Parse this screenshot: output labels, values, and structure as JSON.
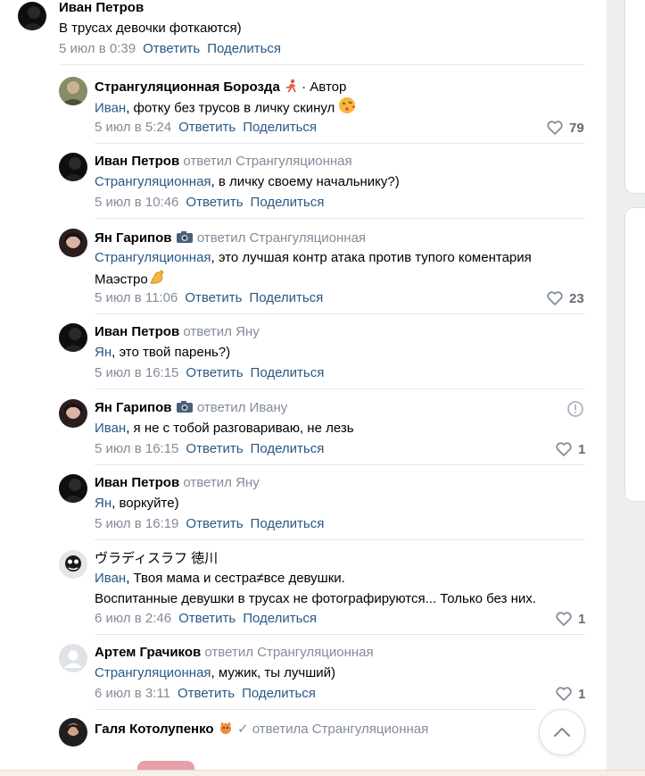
{
  "comments": [
    {
      "name": "Иван Петров",
      "reply": "",
      "tag": "",
      "text_mention": "",
      "text": "В трусах девочки фоткаются)",
      "date": "5 июл в 0:39",
      "reply_btn": "Ответить",
      "share_btn": "Поделиться",
      "likes": ""
    },
    {
      "name": "Странгуляционная Борозда",
      "reply": "",
      "tag": "· Автор",
      "text_mention": "Иван",
      "text": ", фотку без трусов в личку скинул",
      "date": "5 июл в 5:24",
      "reply_btn": "Ответить",
      "share_btn": "Поделиться",
      "likes": "79"
    },
    {
      "name": "Иван Петров",
      "reply": "ответил Странгуляционная",
      "tag": "",
      "text_mention": "Странгуляционная",
      "text": ", в личку своему начальнику?)",
      "date": "5 июл в 10:46",
      "reply_btn": "Ответить",
      "share_btn": "Поделиться",
      "likes": ""
    },
    {
      "name": "Ян Гарипов",
      "reply": "ответил Странгуляционная",
      "tag": "",
      "text_mention": "Странгуляционная",
      "text": ", это лучшая контр атака против тупого коментария",
      "text2": "Маэстро",
      "date": "5 июл в 11:06",
      "reply_btn": "Ответить",
      "share_btn": "Поделиться",
      "likes": "23"
    },
    {
      "name": "Иван Петров",
      "reply": "ответил Яну",
      "tag": "",
      "text_mention": "Ян",
      "text": ", это твой парень?)",
      "date": "5 июл в 16:15",
      "reply_btn": "Ответить",
      "share_btn": "Поделиться",
      "likes": ""
    },
    {
      "name": "Ян Гарипов",
      "reply": "ответил Ивану",
      "tag": "",
      "text_mention": "Иван",
      "text": ", я не с тобой разговариваю, не лезь",
      "date": "5 июл в 16:15",
      "reply_btn": "Ответить",
      "share_btn": "Поделиться",
      "likes": "1"
    },
    {
      "name": "Иван Петров",
      "reply": "ответил Яну",
      "tag": "",
      "text_mention": "Ян",
      "text": ", воркуйте)",
      "date": "5 июл в 16:19",
      "reply_btn": "Ответить",
      "share_btn": "Поделиться",
      "likes": ""
    },
    {
      "name": "ヴラディスラフ 徳川",
      "reply": "",
      "tag": "",
      "text_mention": "Иван",
      "text": ", Твоя мама и сестра≠все девушки.",
      "text2": "Воспитанные девушки в трусах не фотографируются... Только без них.",
      "date": "6 июл в 2:46",
      "reply_btn": "Ответить",
      "share_btn": "Поделиться",
      "likes": "1"
    },
    {
      "name": "Артем Грачиков",
      "reply": "ответил Странгуляционная",
      "tag": "",
      "text_mention": "Странгуляционная",
      "text": ", мужик, ты лучший)",
      "date": "6 июл в 3:11",
      "reply_btn": "Ответить",
      "share_btn": "Поделиться",
      "likes": "1"
    },
    {
      "name": "Галя Котолупенко",
      "reply": "ответила Странгуляционная",
      "tag": "",
      "text_mention": "",
      "text": "",
      "date": "",
      "reply_btn": "",
      "share_btn": "",
      "likes": ""
    }
  ],
  "icons": {
    "like": "heart-icon",
    "camera": "camera-icon",
    "scroll": "chevron-up-icon",
    "info": "info-icon"
  },
  "colors": {
    "link": "#2a5885",
    "muted": "#818c99",
    "like": "#626d7a",
    "background": "#edeef0"
  }
}
